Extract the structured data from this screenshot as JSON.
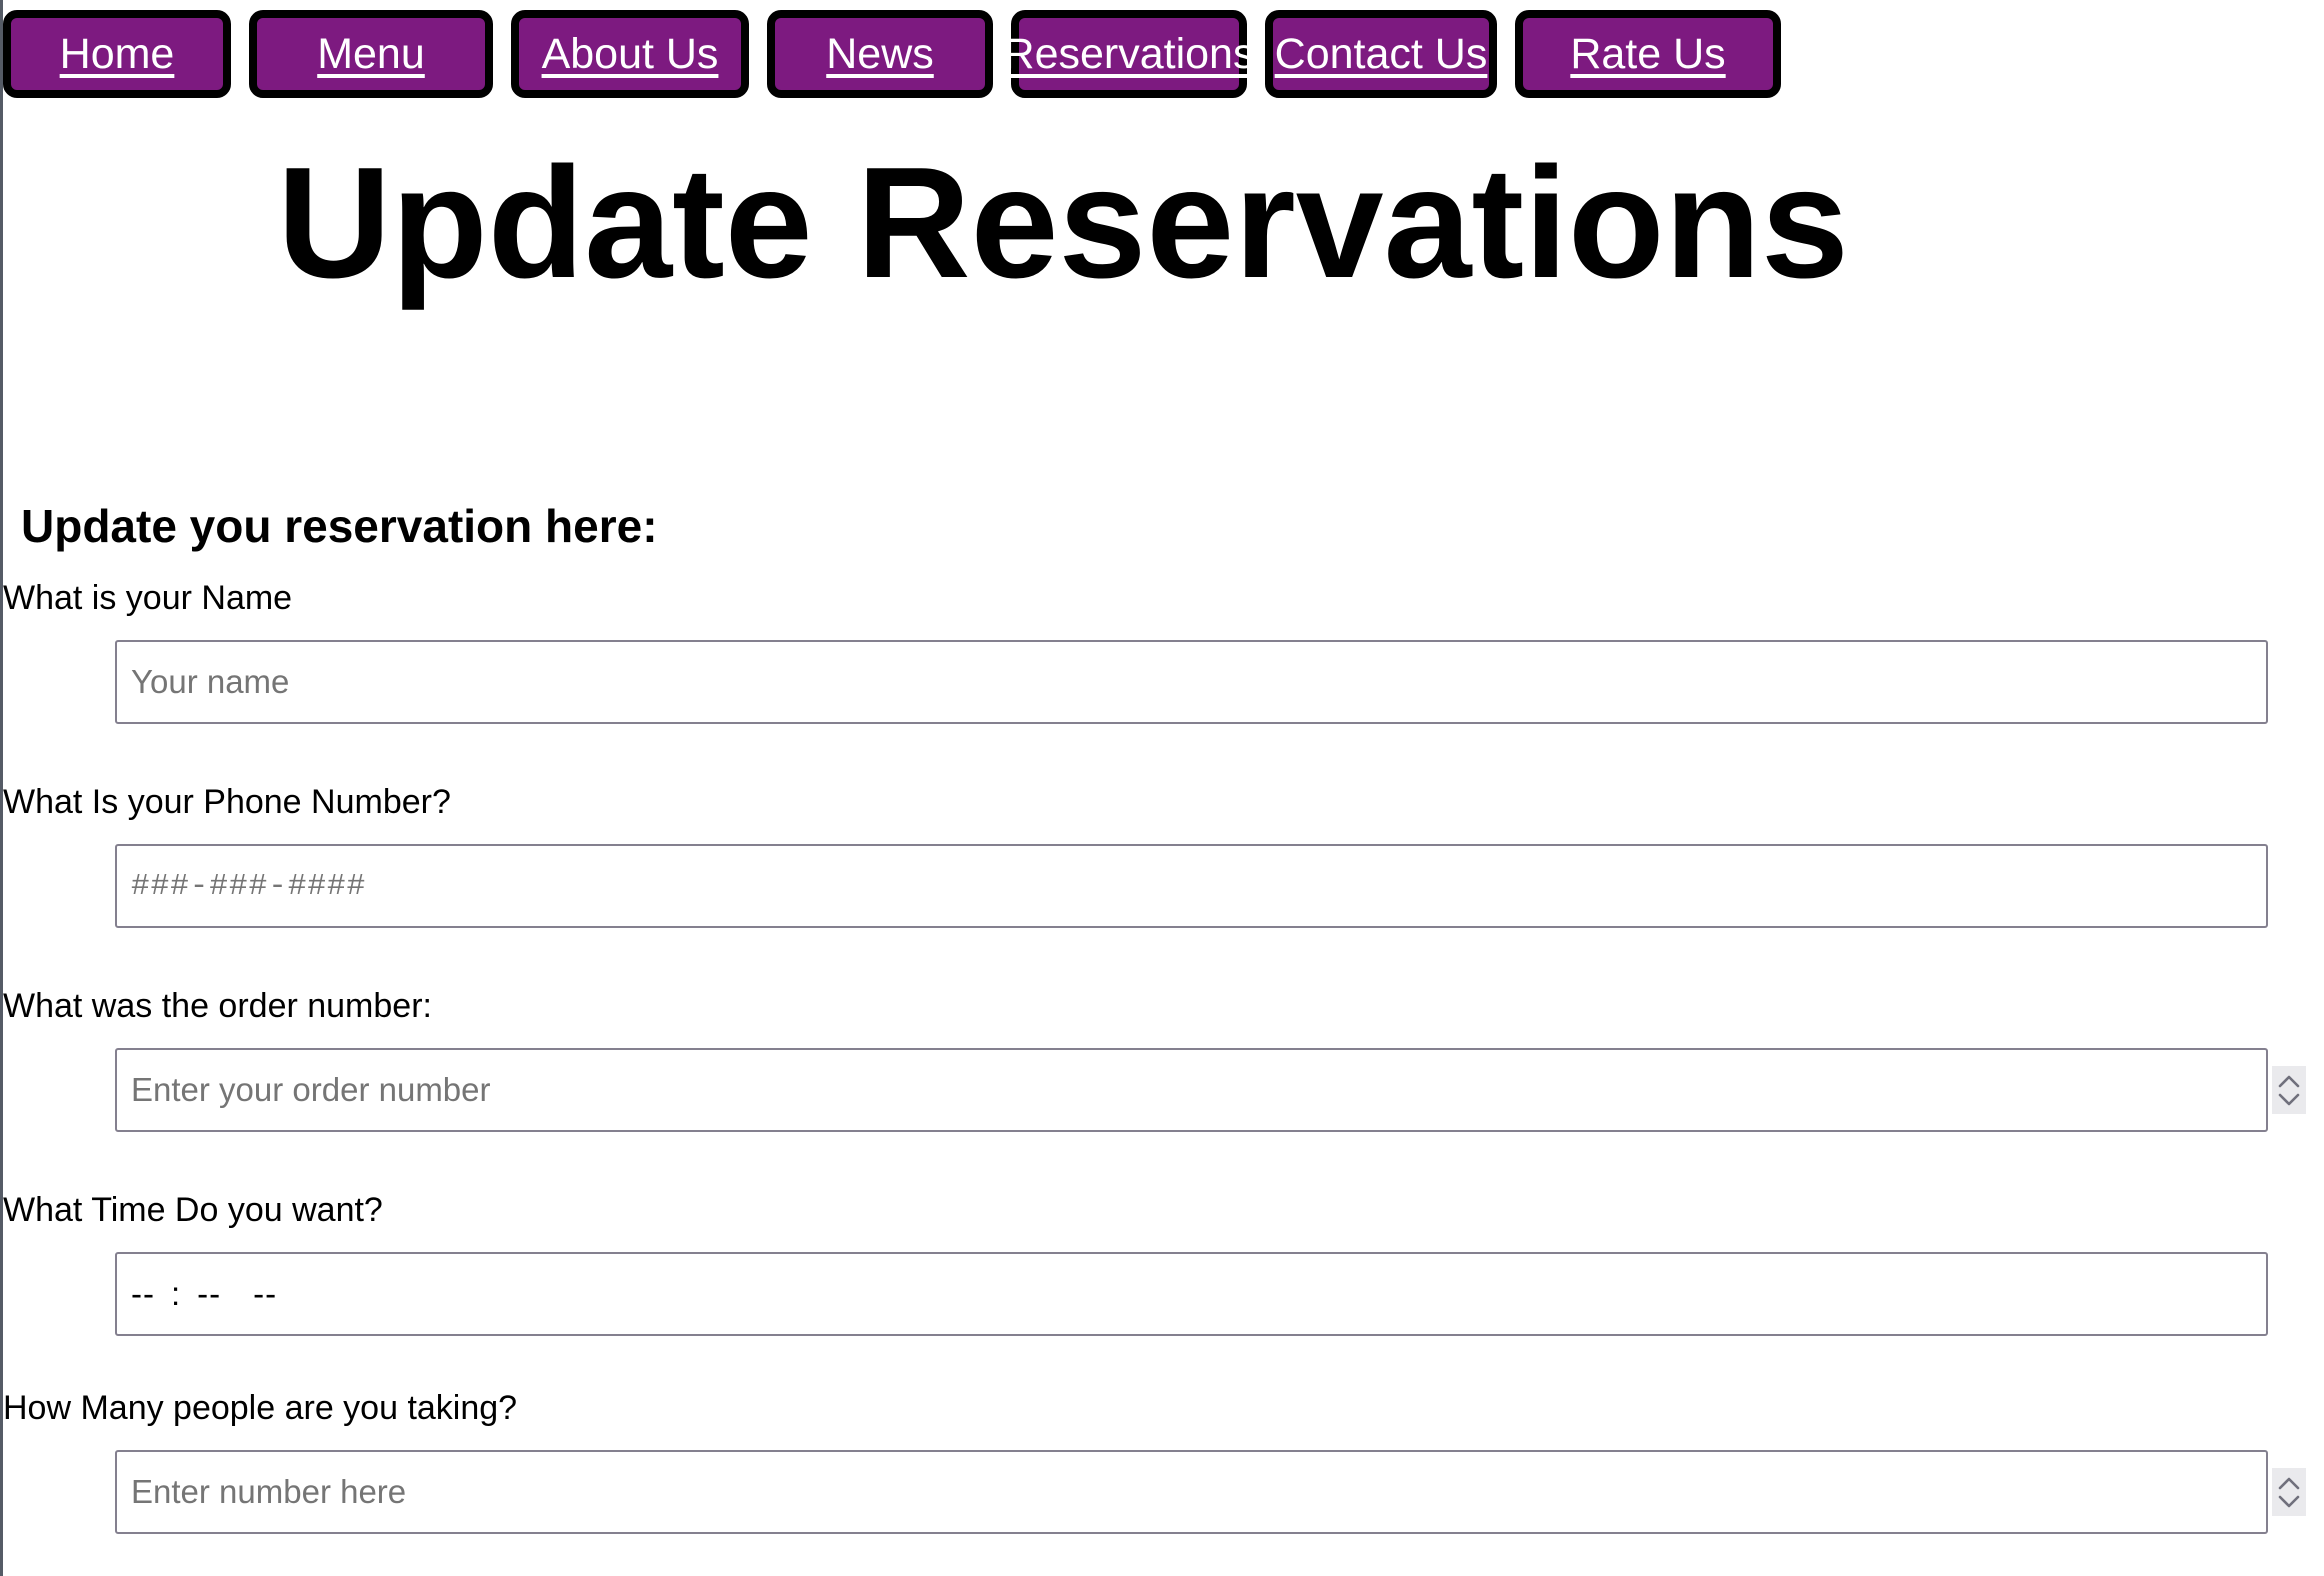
{
  "nav": {
    "items": [
      {
        "label": "Home",
        "name": "nav-link-home"
      },
      {
        "label": "Menu",
        "name": "nav-link-menu"
      },
      {
        "label": "About Us",
        "name": "nav-link-about-us"
      },
      {
        "label": "News",
        "name": "nav-link-news"
      },
      {
        "label": "Reservations",
        "name": "nav-link-reservations"
      },
      {
        "label": "Contact Us",
        "name": "nav-link-contact-us"
      },
      {
        "label": "Rate Us",
        "name": "nav-link-rate-us"
      }
    ],
    "background_color": "#7d1a80",
    "border_color": "#000000",
    "text_color": "#ffffff"
  },
  "header": {
    "title": "Update Reservations"
  },
  "main": {
    "section_heading": "Update you reservation here:",
    "fields": [
      {
        "label": "What is your Name",
        "placeholder": "Your name",
        "value": "",
        "type": "text"
      },
      {
        "label": "What Is your Phone Number?",
        "placeholder": "###-###-####",
        "value": "",
        "type": "tel"
      },
      {
        "label": "What was the order number:",
        "placeholder": "Enter your order number",
        "value": "",
        "type": "number"
      },
      {
        "label": "What Time Do you want?",
        "placeholder": "",
        "value": "",
        "type": "time",
        "time_display": {
          "hour": "--",
          "separator": ":",
          "minute": "--",
          "meridiem": "--"
        }
      },
      {
        "label": "How Many people are you taking?",
        "placeholder": "Enter number here",
        "value": "",
        "type": "number"
      }
    ]
  },
  "style": {
    "input_border_color": "#84808f",
    "placeholder_color": "#757575",
    "spinner_background": "#eaeaed"
  }
}
